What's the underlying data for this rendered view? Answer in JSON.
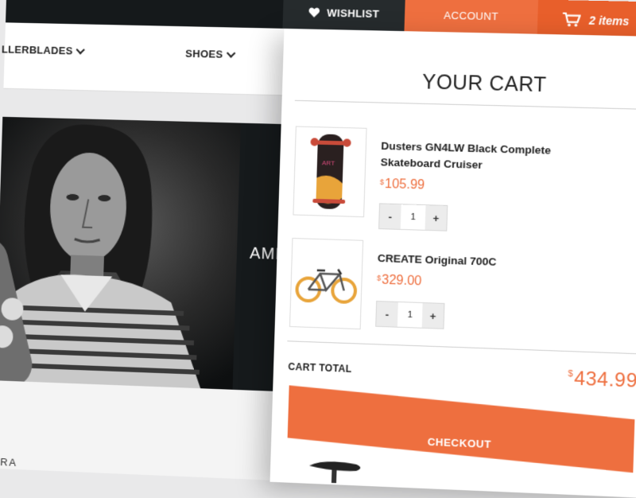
{
  "nav": {
    "items": [
      {
        "label": "LLERBLADES"
      },
      {
        "label": "SHOES"
      }
    ]
  },
  "hero": {
    "headline": "AME"
  },
  "below": {
    "text": "BRA"
  },
  "header": {
    "wishlist_label": "WISHLIST",
    "account_label": "ACCOUNT",
    "cart_count": "2 items",
    "cart_sep": "|",
    "cart_amount": "$"
  },
  "cart": {
    "title": "YOUR CART",
    "items": [
      {
        "name": "Dusters GN4LW Black Complete Skateboard Cruiser",
        "currency": "$",
        "price": "105.99",
        "quantity": "1",
        "minus": "-",
        "plus": "+"
      },
      {
        "name": "CREATE Original 700C",
        "currency": "$",
        "price": "329.00",
        "quantity": "1",
        "minus": "-",
        "plus": "+"
      }
    ],
    "total_label": "CART TOTAL",
    "total_currency": "$",
    "total_value": "434.99",
    "checkout_label": "CHECKOUT"
  },
  "colors": {
    "accent": "#ee6f3f",
    "accent_dark": "#e85f2b",
    "topbar": "#15191b",
    "wishlist_bg": "#262b2d"
  }
}
